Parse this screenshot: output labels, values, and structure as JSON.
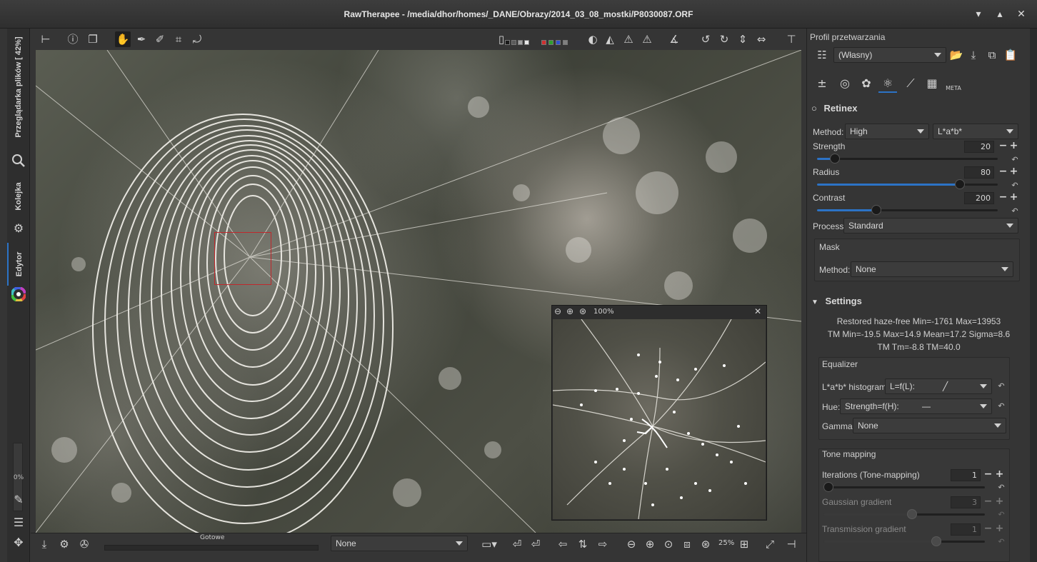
{
  "window": {
    "title": "RawTherapee  - /media/dhor/homes/_DANE/Obrazy/2014_03_08_mostki/P8030087.ORF",
    "minimize": "▾",
    "maximize": "▴",
    "close": "✕"
  },
  "left_tabs": {
    "file_browser": "Przeglądarka plików [ 42%]",
    "queue": "Kolejka",
    "editor": "Edytor",
    "progress": "0%"
  },
  "toolbar": {
    "swatch_colors": [
      "#1a1a1a",
      "#5a5a5a",
      "#a0a0a0",
      "#e8e8e8",
      "#d03030",
      "#30a030",
      "#3050d0",
      "#808080"
    ]
  },
  "detail": {
    "zoom": "100%",
    "close": "✕"
  },
  "bottom": {
    "status": "Gotowe",
    "none_select": "None",
    "zoom": "25%"
  },
  "panel": {
    "profile_label": "Profil przetwarzania",
    "profile_value": "(Własny)",
    "retinex_title": "Retinex",
    "method_label": "Method:",
    "method_value": "High",
    "colorspace_value": "L*a*b*",
    "strength_label": "Strength",
    "strength_value": "20",
    "strength_fraction": 0.1,
    "radius_label": "Radius",
    "radius_value": "80",
    "radius_fraction": 0.79,
    "contrast_label": "Contrast",
    "contrast_value": "200",
    "contrast_fraction": 0.33,
    "process_label": "Process:",
    "process_value": "Standard",
    "mask_label": "Mask",
    "mask_method_label": "Method:",
    "mask_method_value": "None",
    "settings_title": "Settings",
    "info_line1": "Restored haze-free Min=-1761 Max=13953",
    "info_line2": "TM Min=-19.5 Max=14.9 Mean=17.2 Sigma=8.6",
    "info_line3": "TM Tm=-8.8 TM=40.0",
    "equalizer_label": "Equalizer",
    "lab_hist_label": "L*a*b* histogram:",
    "lab_hist_value": "L=f(L):",
    "hue_label": "Hue:",
    "hue_value": "Strength=f(H):",
    "gamma_label": "Gamma:",
    "gamma_value": "None",
    "tonemap_label": "Tone mapping",
    "iterations_label": "Iterations (Tone-mapping)",
    "iterations_value": "1",
    "iterations_fraction": 0.0,
    "gaussian_label": "Gaussian gradient",
    "gaussian_value": "3",
    "gaussian_fraction": 0.55,
    "transmission_label": "Transmission gradient",
    "transmission_value": "1",
    "transmission_fraction": 0.7,
    "meta_tab": "META"
  }
}
